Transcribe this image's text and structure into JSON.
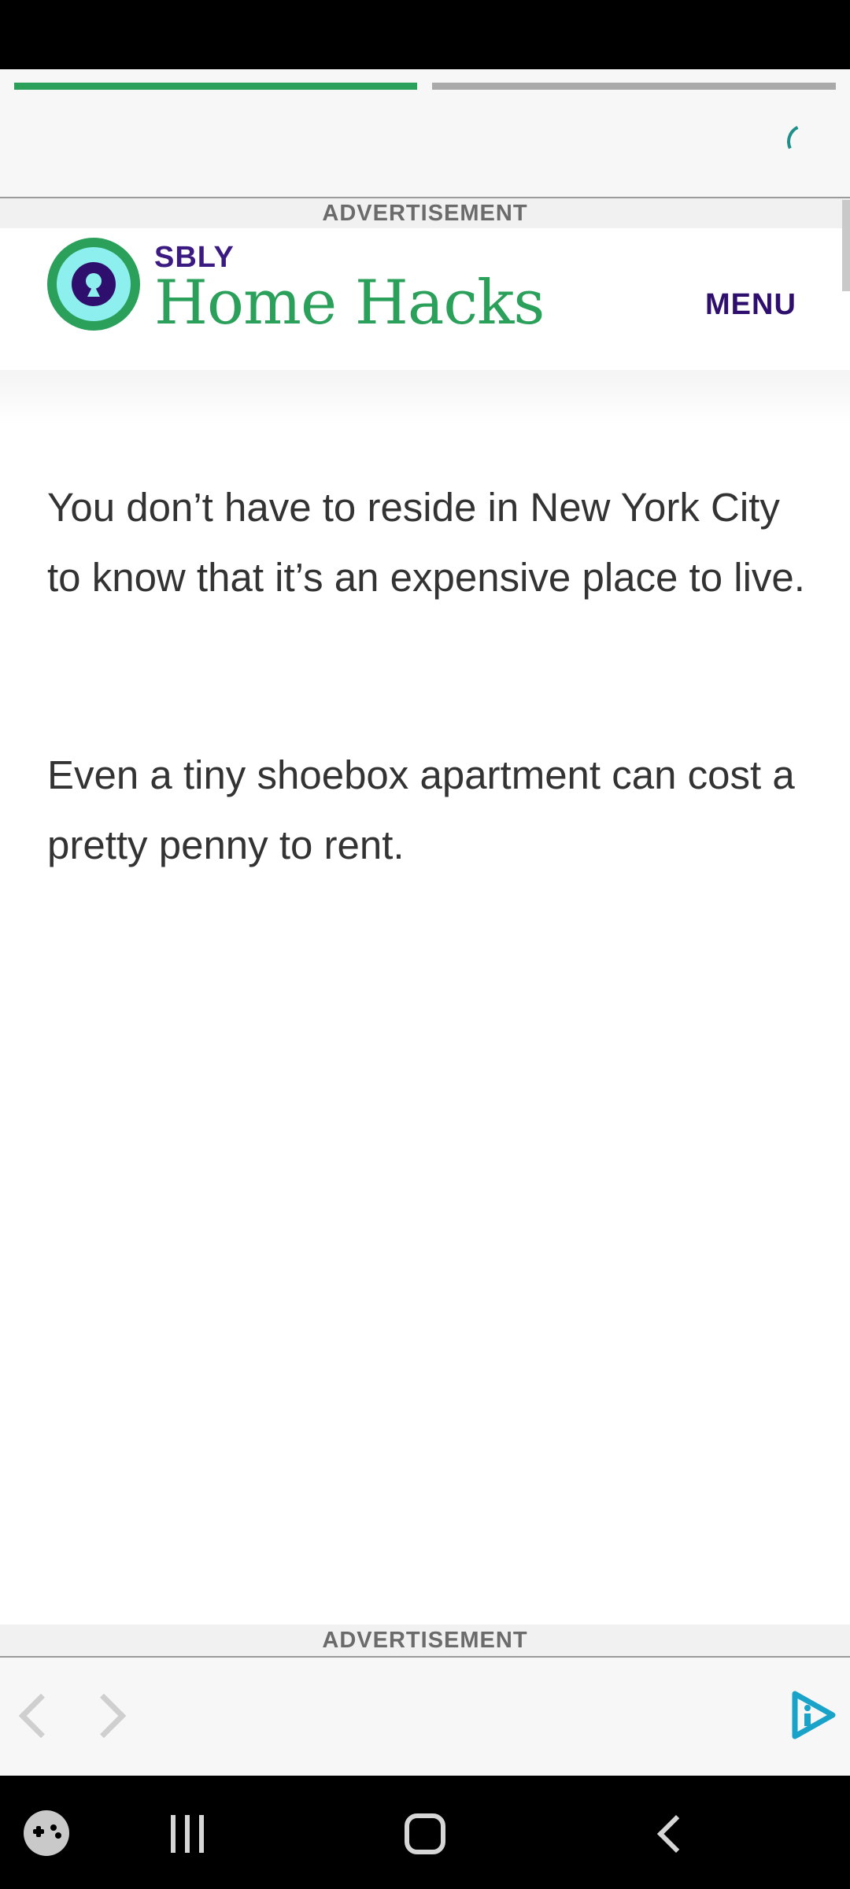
{
  "story": {
    "progress_segments": [
      {
        "state": "active",
        "color": "#2aa05a"
      },
      {
        "state": "inactive",
        "color": "#aaaaaa"
      }
    ],
    "loading_icon": "spinner-icon"
  },
  "ads": {
    "top_label": "ADVERTISEMENT",
    "bottom_label": "ADVERTISEMENT"
  },
  "site": {
    "brand_small": "SBLY",
    "brand_name": "Home Hacks",
    "menu_label": "MENU",
    "logo_icon": "keyhole-logo-icon",
    "colors": {
      "brand_green": "#2aa05a",
      "brand_purple": "#2f0f6e",
      "logo_teal": "#8ef0ee"
    }
  },
  "article": {
    "paragraphs": [
      "You don’t have to reside in New York City to know that it’s an expensive place to live.",
      "Even a tiny shoebox apartment can cost a pretty penny to rent."
    ]
  },
  "bottom_bar": {
    "back_icon": "chevron-left-icon",
    "forward_icon": "chevron-right-icon",
    "brand_icon": "play-info-icon",
    "accent_color": "#1aa3c8"
  },
  "system_nav": {
    "game_icon": "gamepad-icon",
    "recent_icon": "recent-apps-icon",
    "home_icon": "home-icon",
    "back_icon": "back-icon"
  }
}
